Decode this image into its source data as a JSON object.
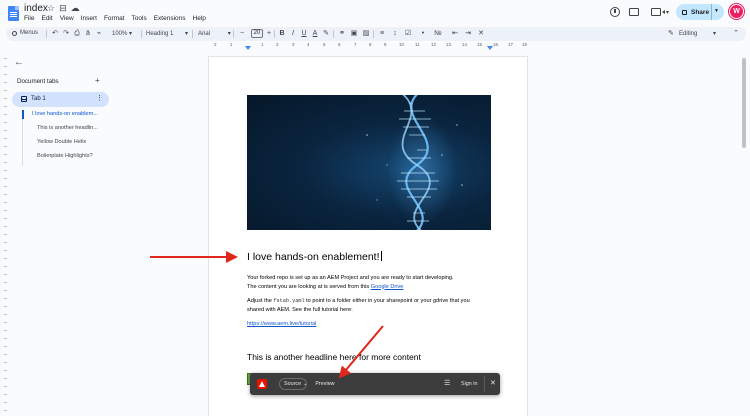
{
  "doc": {
    "title": "index",
    "title_icons": [
      "star-icon",
      "move-folder-icon",
      "cloud-status-icon"
    ]
  },
  "menu": [
    "File",
    "Edit",
    "View",
    "Insert",
    "Format",
    "Tools",
    "Extensions",
    "Help"
  ],
  "header": {
    "share_label": "Share",
    "avatar_initial": "W",
    "avatar_color": "#e91e63",
    "share_bg": "#c2e7ff"
  },
  "toolbar": {
    "search_label": "Menus",
    "zoom": "100%",
    "style": "Heading 1",
    "font": "Arial",
    "font_size": "20",
    "editing_label": "Editing",
    "bg": "#edf2fa"
  },
  "ruler": {
    "numbers": [
      "2",
      "1",
      "1",
      "2",
      "3",
      "4",
      "5",
      "6",
      "7",
      "8",
      "9",
      "10",
      "11",
      "12",
      "13",
      "14",
      "15",
      "16",
      "17",
      "18",
      "19"
    ]
  },
  "sidebar": {
    "tabs_title": "Document tabs",
    "active_tab": "Tab 1",
    "outline": [
      "I love hands-on enablem...",
      "This is another headlin...",
      "Yellow Double Helix",
      "Boilerplate Highlights?"
    ],
    "active_bg": "#d3e3fd",
    "accent": "#0b57d0"
  },
  "document": {
    "heading": "I love hands-on enablement!",
    "para1_line1": "Your forked repo is set up as an AEM Project and you are ready to start developing.",
    "para1_line2_pre": "The content you are looking at is served from this ",
    "para1_link": "Google Drive",
    "para2_pre": "Adjust the ",
    "para2_code": "fstab.yaml",
    "para2_post": " to point to a folder either in your sharepoint or your gdrive that you",
    "para2_line2": "shared with AEM. See the full tutorial here:",
    "tutorial_link": "https://www.aem.live/tutorial",
    "heading2": "This is another headline here for more content"
  },
  "aem_toolbar": {
    "source_label": "Source",
    "preview_label": "Preview",
    "signin_label": "Sign in",
    "bg": "#3c3c3c",
    "logo_color": "#eb1000"
  },
  "annotations": {
    "arrow_color": "#e0271d"
  }
}
